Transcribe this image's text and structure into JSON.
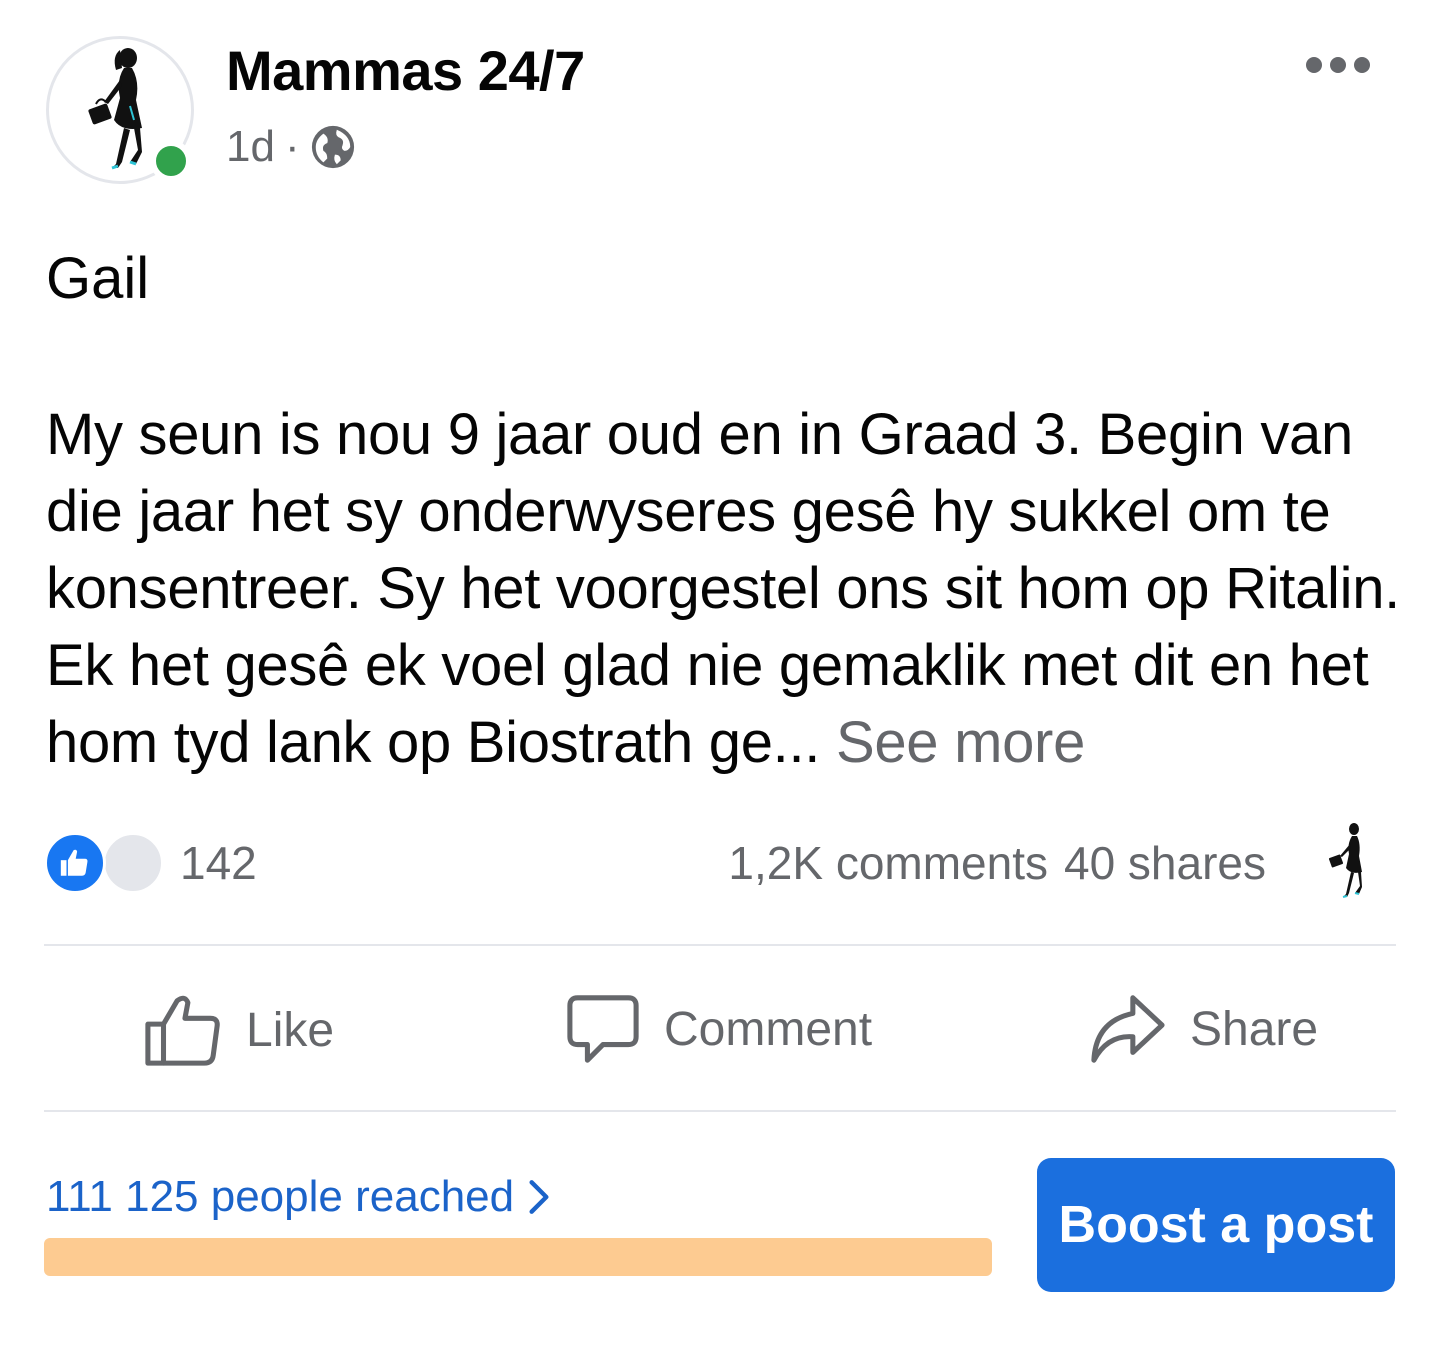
{
  "header": {
    "page_name": "Mammas 24/7",
    "time": "1d",
    "separator": "·",
    "privacy_icon": "globe-icon",
    "more_icon": "more-dots-icon",
    "online_status_color": "#31a24c"
  },
  "post": {
    "author": "Gail",
    "text": "My seun is nou 9 jaar oud en in Graad 3. Begin van die jaar het sy onderwyseres gesê hy sukkel om te konsentreer. Sy het voorgestel ons sit hom op Ritalin. Ek het gesê ek voel glad nie gemaklik met dit en het hom tyd lank op Biostrath ge...",
    "see_more": "See more"
  },
  "engagement": {
    "reaction_icon": "like-reaction-icon",
    "reaction_count": "142",
    "comments": "1,2K comments",
    "shares": "40 shares"
  },
  "actions": {
    "like": "Like",
    "comment": "Comment",
    "share": "Share"
  },
  "insights": {
    "reach_text": "111 125 people reached",
    "reach_bar_color": "#fdcb91",
    "boost_label": "Boost a post",
    "boost_color": "#1b6fde"
  }
}
